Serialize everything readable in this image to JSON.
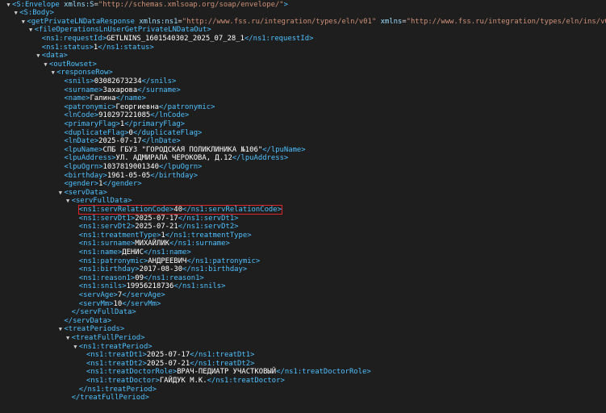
{
  "colors": {
    "background": "#1e1e1e",
    "tag": "#4fc1ff",
    "text": "#ffffff",
    "highlight": "#e0242b"
  },
  "xml": [
    {
      "level": 0,
      "arrow": true,
      "kind": "open",
      "tag": "S:Envelope",
      "attrs": [
        {
          "name": "xmlns:S",
          "value": "\"http://schemas.xmlsoap.org/soap/envelope/\""
        }
      ]
    },
    {
      "level": 1,
      "arrow": true,
      "kind": "open",
      "tag": "S:Body"
    },
    {
      "level": 2,
      "arrow": true,
      "kind": "open",
      "tag": "getPrivateLNDataResponse",
      "attrs": [
        {
          "name": "xmlns:ns1",
          "value": "\"http://www.fss.ru/integration/types/eln/v01\""
        },
        {
          "name": "xmlns",
          "value": "\"http://www.fss.ru/integration/types/eln/ins/v01\""
        }
      ]
    },
    {
      "level": 3,
      "arrow": true,
      "kind": "open",
      "tag": "fileOperationsLnUserGetPrivateLNDataOut"
    },
    {
      "level": 4,
      "arrow": false,
      "kind": "element",
      "tag": "ns1:requestId",
      "text": "GETLNINS_1601540302_2025_07_28_1"
    },
    {
      "level": 4,
      "arrow": false,
      "kind": "element",
      "tag": "ns1:status",
      "text": "1"
    },
    {
      "level": 4,
      "arrow": true,
      "kind": "open",
      "tag": "data"
    },
    {
      "level": 5,
      "arrow": true,
      "kind": "open",
      "tag": "outRowset"
    },
    {
      "level": 6,
      "arrow": true,
      "kind": "open",
      "tag": "responseRow"
    },
    {
      "level": 7,
      "arrow": false,
      "kind": "element",
      "tag": "snils",
      "text": "03082673234"
    },
    {
      "level": 7,
      "arrow": false,
      "kind": "element",
      "tag": "surname",
      "text": "Захарова"
    },
    {
      "level": 7,
      "arrow": false,
      "kind": "element",
      "tag": "name",
      "text": "Галина"
    },
    {
      "level": 7,
      "arrow": false,
      "kind": "element",
      "tag": "patronymic",
      "text": "Георгиевна"
    },
    {
      "level": 7,
      "arrow": false,
      "kind": "element",
      "tag": "lnCode",
      "text": "910297221085"
    },
    {
      "level": 7,
      "arrow": false,
      "kind": "element",
      "tag": "primaryFlag",
      "text": "1"
    },
    {
      "level": 7,
      "arrow": false,
      "kind": "element",
      "tag": "duplicateFlag",
      "text": "0"
    },
    {
      "level": 7,
      "arrow": false,
      "kind": "element",
      "tag": "lnDate",
      "text": "2025-07-17"
    },
    {
      "level": 7,
      "arrow": false,
      "kind": "element",
      "tag": "lpuName",
      "text": "СПБ ГБУЗ \"ГОРОДСКАЯ ПОЛИКЛИНИКА №106\""
    },
    {
      "level": 7,
      "arrow": false,
      "kind": "element",
      "tag": "lpuAddress",
      "text": "УЛ. АДМИРАЛА ЧЕРОКОВА, Д.12"
    },
    {
      "level": 7,
      "arrow": false,
      "kind": "element",
      "tag": "lpuOgrn",
      "text": "1037819001340"
    },
    {
      "level": 7,
      "arrow": false,
      "kind": "element",
      "tag": "birthday",
      "text": "1961-05-05"
    },
    {
      "level": 7,
      "arrow": false,
      "kind": "element",
      "tag": "gender",
      "text": "1"
    },
    {
      "level": 7,
      "arrow": true,
      "kind": "open",
      "tag": "servData"
    },
    {
      "level": 8,
      "arrow": true,
      "kind": "open",
      "tag": "servFullData"
    },
    {
      "level": 9,
      "arrow": false,
      "kind": "element",
      "tag": "ns1:servRelationCode",
      "text": "40",
      "highlight": true
    },
    {
      "level": 9,
      "arrow": false,
      "kind": "element",
      "tag": "ns1:servDt1",
      "text": "2025-07-17"
    },
    {
      "level": 9,
      "arrow": false,
      "kind": "element",
      "tag": "ns1:servDt2",
      "text": "2025-07-21"
    },
    {
      "level": 9,
      "arrow": false,
      "kind": "element",
      "tag": "ns1:treatmentType",
      "text": "1"
    },
    {
      "level": 9,
      "arrow": false,
      "kind": "element",
      "tag": "ns1:surname",
      "text": "МИХАЙЛИК"
    },
    {
      "level": 9,
      "arrow": false,
      "kind": "element",
      "tag": "ns1:name",
      "text": "ДЕНИС"
    },
    {
      "level": 9,
      "arrow": false,
      "kind": "element",
      "tag": "ns1:patronymic",
      "text": "АНДРЕЕВИЧ"
    },
    {
      "level": 9,
      "arrow": false,
      "kind": "element",
      "tag": "ns1:birthday",
      "text": "2017-08-30"
    },
    {
      "level": 9,
      "arrow": false,
      "kind": "element",
      "tag": "ns1:reason1",
      "text": "09"
    },
    {
      "level": 9,
      "arrow": false,
      "kind": "element",
      "tag": "ns1:snils",
      "text": "19956218736"
    },
    {
      "level": 9,
      "arrow": false,
      "kind": "element",
      "tag": "servAge",
      "text": "7"
    },
    {
      "level": 9,
      "arrow": false,
      "kind": "element",
      "tag": "servMm",
      "text": "10"
    },
    {
      "level": 8,
      "arrow": false,
      "kind": "close",
      "tag": "servFullData"
    },
    {
      "level": 7,
      "arrow": false,
      "kind": "close",
      "tag": "servData"
    },
    {
      "level": 7,
      "arrow": true,
      "kind": "open",
      "tag": "treatPeriods"
    },
    {
      "level": 8,
      "arrow": true,
      "kind": "open",
      "tag": "treatFullPeriod"
    },
    {
      "level": 9,
      "arrow": true,
      "kind": "open",
      "tag": "ns1:treatPeriod"
    },
    {
      "level": 10,
      "arrow": false,
      "kind": "element",
      "tag": "ns1:treatDt1",
      "text": "2025-07-17"
    },
    {
      "level": 10,
      "arrow": false,
      "kind": "element",
      "tag": "ns1:treatDt2",
      "text": "2025-07-21"
    },
    {
      "level": 10,
      "arrow": false,
      "kind": "element",
      "tag": "ns1:treatDoctorRole",
      "text": "ВРАЧ-ПЕДИАТР УЧАСТКОВЫЙ"
    },
    {
      "level": 10,
      "arrow": false,
      "kind": "element",
      "tag": "ns1:treatDoctor",
      "text": "ГАЙДУК М.К."
    },
    {
      "level": 9,
      "arrow": false,
      "kind": "close",
      "tag": "ns1:treatPeriod"
    },
    {
      "level": 8,
      "arrow": false,
      "kind": "close",
      "tag": "treatFullPeriod"
    }
  ]
}
